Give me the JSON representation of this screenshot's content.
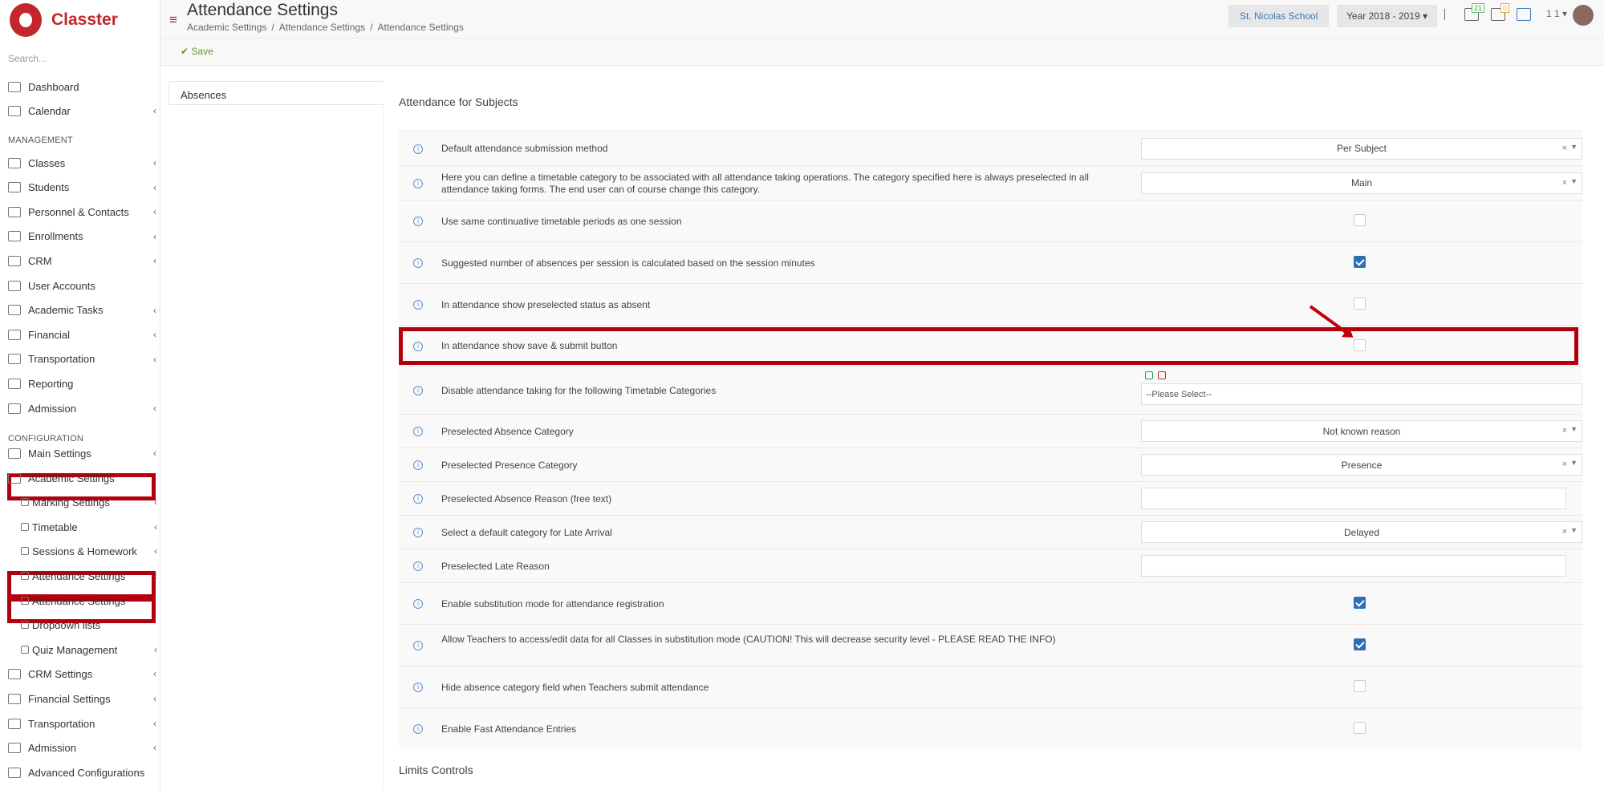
{
  "app": {
    "name": "Classter"
  },
  "sidebar": {
    "search_placeholder": "Search...",
    "top_items": [
      {
        "label": "Dashboard"
      },
      {
        "label": "Calendar",
        "chevron": "‹"
      }
    ],
    "management_label": "MANAGEMENT",
    "management_items": [
      {
        "label": "Classes",
        "chevron": "‹"
      },
      {
        "label": "Students",
        "chevron": "‹"
      },
      {
        "label": "Personnel & Contacts",
        "chevron": "‹"
      },
      {
        "label": "Enrollments",
        "chevron": "‹"
      },
      {
        "label": "CRM",
        "chevron": "‹"
      },
      {
        "label": "User Accounts"
      },
      {
        "label": "Academic Tasks",
        "chevron": "‹"
      },
      {
        "label": "Financial",
        "chevron": "‹"
      },
      {
        "label": "Transportation",
        "chevron": "‹"
      },
      {
        "label": "Reporting"
      },
      {
        "label": "Admission",
        "chevron": "‹"
      }
    ],
    "configuration_label": "CONFIGURATION",
    "configuration_items": [
      {
        "label": "Main Settings",
        "chevron": "‹"
      },
      {
        "label": "Academic Settings"
      },
      {
        "label": "Marking Settings",
        "chevron": "‹"
      },
      {
        "label": "Timetable",
        "chevron": "‹"
      },
      {
        "label": "Sessions & Homework",
        "chevron": "‹"
      },
      {
        "label": "Attendance Settings",
        "chevron": "‹"
      },
      {
        "label": "Attendance Settings"
      },
      {
        "label": "Dropdown lists"
      },
      {
        "label": "Quiz Management",
        "chevron": "‹"
      },
      {
        "label": "CRM Settings",
        "chevron": "‹"
      },
      {
        "label": "Financial Settings",
        "chevron": "‹"
      },
      {
        "label": "Transportation",
        "chevron": "‹"
      },
      {
        "label": "Admission",
        "chevron": "‹"
      },
      {
        "label": "Advanced Configurations"
      }
    ]
  },
  "header": {
    "title": "Attendance Settings",
    "breadcrumb": [
      "Academic Settings",
      "/",
      "Attendance Settings",
      "/",
      "Attendance Settings"
    ],
    "school": "St. Nicolas School",
    "year": "Year 2018 - 2019 ▾",
    "badge_notifications": "21",
    "badge_messages": "0",
    "user_count": "1 1 ▾"
  },
  "actions": {
    "save_label": "✔ Save"
  },
  "tabs": {
    "absences": "Absences"
  },
  "content": {
    "section_title": "Attendance for Subjects",
    "limits_title": "Limits Controls",
    "info_glyph": "i",
    "clear_glyph": "×",
    "arrow_glyph": "▼",
    "rows": [
      {
        "label": "Default attendance submission method",
        "value": "Per Subject"
      },
      {
        "label": "Here you can define a timetable category to be associated with all attendance taking operations. The category specified here is always preselected in all attendance taking forms. The end user can of course change this category.",
        "value": "Main"
      },
      {
        "label": "Use same continuative timetable periods as one session",
        "checked": false
      },
      {
        "label": "Suggested number of absences per session is calculated based on the session minutes",
        "checked": true
      },
      {
        "label": "In attendance show preselected status as absent",
        "checked": false
      },
      {
        "label": "In attendance show save & submit button",
        "checked": false
      },
      {
        "label": "Disable attendance taking for the following Timetable Categories",
        "placeholder": "--Please Select--"
      },
      {
        "label": "Preselected Absence Category",
        "value": "Not known reason"
      },
      {
        "label": "Preselected Presence Category",
        "value": "Presence"
      },
      {
        "label": "Preselected Absence Reason (free text)",
        "value": ""
      },
      {
        "label": "Select a default category for Late Arrival",
        "value": "Delayed"
      },
      {
        "label": "Preselected Late Reason",
        "value": ""
      },
      {
        "label": "Enable substitution mode for attendance registration",
        "checked": true
      },
      {
        "label": "Allow Teachers to access/edit data for all Classes in substitution mode (CAUTION! This will decrease security level - PLEASE READ THE INFO)",
        "checked": true
      },
      {
        "label": "Hide absence category field when Teachers submit attendance",
        "checked": false
      },
      {
        "label": "Enable Fast Attendance Entries",
        "checked": false
      }
    ]
  },
  "colors": {
    "brand": "#c1272d",
    "highlight": "#b3000f",
    "checkbox": "#2f6fb3"
  }
}
